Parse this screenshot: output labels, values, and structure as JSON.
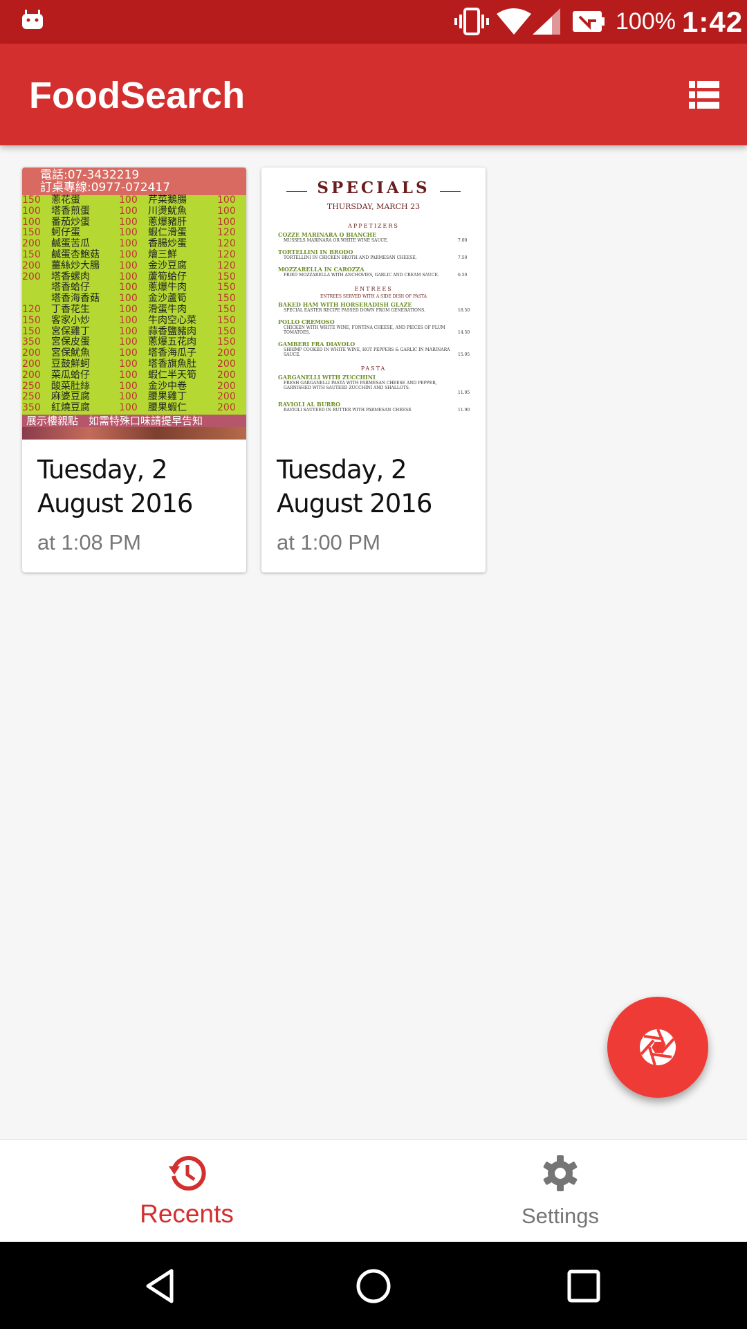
{
  "status_bar": {
    "battery_percent": "100%",
    "time": "1:42",
    "icons": [
      "android-debug-icon",
      "vibrate-icon",
      "wifi-icon",
      "signal-icon",
      "battery-saver-icon"
    ]
  },
  "app_bar": {
    "title": "FoodSearch",
    "view_toggle_icon": "view-list-icon"
  },
  "recents": [
    {
      "thumbnail": "chinese-menu-photo",
      "date": "Tuesday, 2 August 2016",
      "time": "at 1:08 PM",
      "menu": {
        "header": [
          "電話:07-3432219",
          "訂桌專線:0977-072417"
        ],
        "rows": [
          [
            "150",
            "蔥花蛋",
            "100",
            "芹菜鵝腸",
            "100"
          ],
          [
            "100",
            "塔香煎蛋",
            "100",
            "川燙魷魚",
            "100"
          ],
          [
            "100",
            "番茄炒蛋",
            "100",
            "蔥爆豬肝",
            "100"
          ],
          [
            "150",
            "蚵仔蛋",
            "100",
            "蝦仁滑蛋",
            "120"
          ],
          [
            "200",
            "鹹蛋苦瓜",
            "100",
            "香腸炒蛋",
            "120"
          ],
          [
            "150",
            "鹹蛋杏鮑菇",
            "100",
            "燴三鮮",
            "120"
          ],
          [
            "200",
            "薑絲炒大腸",
            "100",
            "金沙豆腐",
            "120"
          ],
          [
            "200",
            "塔香螺肉",
            "100",
            "蘆筍蛤仔",
            "150"
          ],
          [
            "",
            "塔香蛤仔",
            "100",
            "蔥爆牛肉",
            "150"
          ],
          [
            "",
            "塔香海香菇",
            "100",
            "金沙蘆筍",
            "150"
          ],
          [
            "120",
            "丁香花生",
            "100",
            "滑蛋牛肉",
            "150"
          ],
          [
            "150",
            "客家小炒",
            "100",
            "牛肉空心菜",
            "150"
          ],
          [
            "150",
            "宮保雞丁",
            "100",
            "蒜香鹽豬肉",
            "150"
          ],
          [
            "350",
            "宮保皮蛋",
            "100",
            "蔥爆五花肉",
            "150"
          ],
          [
            "200",
            "宮保魷魚",
            "100",
            "塔香海瓜子",
            "200"
          ],
          [
            "200",
            "豆鼓鮮蚵",
            "100",
            "塔香旗魚肚",
            "200"
          ],
          [
            "200",
            "菜瓜蛤仔",
            "100",
            "蝦仁半天筍",
            "200"
          ],
          [
            "250",
            "酸菜肚絲",
            "100",
            "金沙中卷",
            "200"
          ],
          [
            "250",
            "麻婆豆腐",
            "100",
            "腰果雞丁",
            "200"
          ],
          [
            "350",
            "紅燒豆腐",
            "100",
            "腰果蝦仁",
            "200"
          ]
        ],
        "footer": "展示樓親點　如需特殊口味請提早告知"
      }
    },
    {
      "thumbnail": "specials-menu-photo",
      "date": "Tuesday, 2 August 2016",
      "time": "at 1:00 PM",
      "menu": {
        "title": "SPECIALS",
        "date": "THURSDAY, MARCH 23",
        "sections": [
          {
            "name": "APPETIZERS",
            "items": [
              {
                "name": "COZZE MARINARA O BIANCHE",
                "desc": "MUSSELS MARINARA OR WHITE WINE SAUCE.",
                "price": "7.00"
              },
              {
                "name": "TORTELLINI IN BRODO",
                "desc": "TORTELLINI IN CHICKEN BROTH AND PARMESAN CHEESE.",
                "price": "7.50"
              },
              {
                "name": "MOZZARELLA IN CAROZZA",
                "desc": "FRIED MOZZARELLA WITH ANCHOVIES, GARLIC AND CREAM SAUCE.",
                "price": "6.50"
              }
            ]
          },
          {
            "name": "ENTREES",
            "note": "ENTREES SERVED WITH A SIDE DISH OF PASTA",
            "items": [
              {
                "name": "BAKED HAM WITH HORSERADISH GLAZE",
                "desc": "SPECIAL EASTER RECIPE PASSED DOWN FROM GENERATIONS.",
                "price": "18.50"
              },
              {
                "name": "POLLO CREMOSO",
                "desc": "CHICKEN WITH WHITE WINE, FONTINA CHEESE, AND PIECES OF PLUM TOMATOES.",
                "price": "14.50"
              },
              {
                "name": "GAMBERI FRA DIAVOLO",
                "desc": "SHRIMP COOKED IN WHITE WINE, HOT PEPPERS & GARLIC IN MARINARA SAUCE.",
                "price": "15.95"
              }
            ]
          },
          {
            "name": "PASTA",
            "items": [
              {
                "name": "GARGANELLI WITH ZUCCHINI",
                "desc": "FRESH GARGANELLI PASTA WITH PARMESAN CHEESE AND PEPPER, GARNISHED WITH SAUTEED ZUCCHINI AND SHALLOTS.",
                "price": "11.95"
              },
              {
                "name": "RAVIOLI AL BURRO",
                "desc": "RAVIOLI SAUTEED IN BUTTER WITH PARMESAN CHEESE.",
                "price": "11.90"
              }
            ]
          }
        ]
      }
    }
  ],
  "fab": {
    "icon": "camera-shutter-icon"
  },
  "bottom_nav": {
    "recents": {
      "label": "Recents",
      "icon": "history-icon",
      "active": true
    },
    "settings": {
      "label": "Settings",
      "icon": "gear-icon",
      "active": false
    }
  },
  "system_nav": {
    "icons": [
      "back-icon",
      "home-icon",
      "overview-icon"
    ]
  },
  "colors": {
    "status_bar": "#b71c1c",
    "app_bar": "#d32f2f",
    "fab": "#ef3b36",
    "active_nav": "#d32f2f",
    "inactive_nav": "#757575",
    "background": "#f6f6f6"
  }
}
